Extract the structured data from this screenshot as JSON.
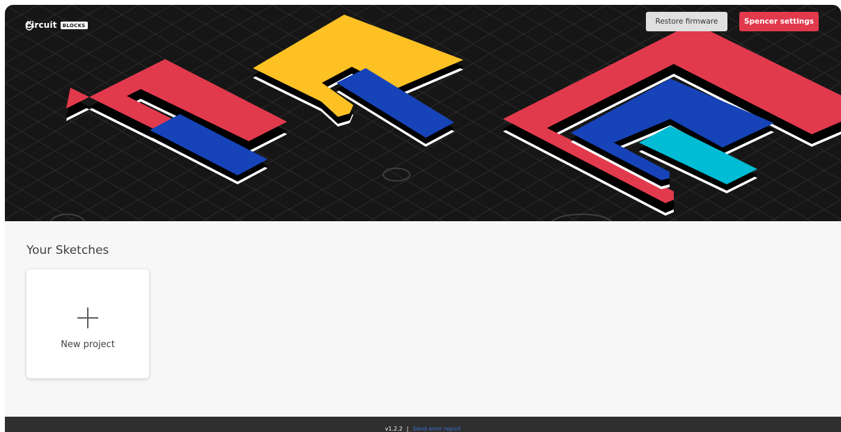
{
  "header": {
    "brand_name": "Circuit",
    "brand_badge": "BLOCKS",
    "restore_button": "Restore firmware",
    "settings_button": "Spencer settings"
  },
  "main": {
    "section_title": "Your Sketches",
    "new_project_label": "New project"
  },
  "footer": {
    "version": "v1.2.2",
    "separator": "|",
    "error_report_link": "Send error report"
  },
  "colors": {
    "hero_background": "#161616",
    "accent_red": "#e23a4d",
    "accent_yellow": "#fdc124",
    "accent_blue": "#1643b8",
    "accent_cyan": "#00bcd4",
    "link_blue": "#3b6fd6"
  }
}
